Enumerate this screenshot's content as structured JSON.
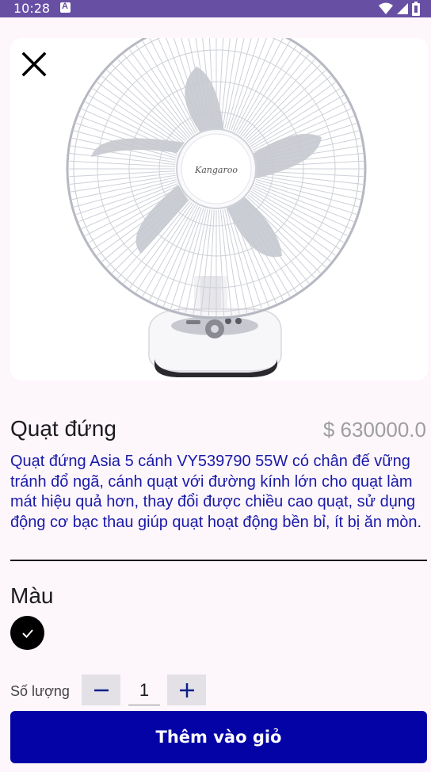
{
  "status_bar": {
    "time": "10:28",
    "icons": [
      "notification-a-icon",
      "wifi-icon",
      "signal-icon",
      "battery-icon"
    ]
  },
  "product": {
    "image_logo": "Kangaroo",
    "name": "Quạt đứng",
    "price": "$ 630000.0",
    "description": "Quạt đứng Asia 5 cánh VY539790 55W  có chân đế vững tránh đổ ngã, cánh quạt với đường kính lớn cho quạt làm mát hiệu quả hơn, thay đổi được chiều cao quạt, sử dụng động cơ bạc thau giúp quạt hoạt động bền bỉ, ít bị ăn mòn."
  },
  "color_section": {
    "label": "Màu",
    "selected_color": "#000000"
  },
  "quantity": {
    "label": "Số lượng",
    "value": "1"
  },
  "actions": {
    "add_to_cart_label": "Thêm vào giỏ"
  },
  "colors": {
    "status_bar": "#6750a4",
    "description_text": "#1a1aa8",
    "primary_button": "#0303a6",
    "price_text": "#9e9e9e"
  }
}
